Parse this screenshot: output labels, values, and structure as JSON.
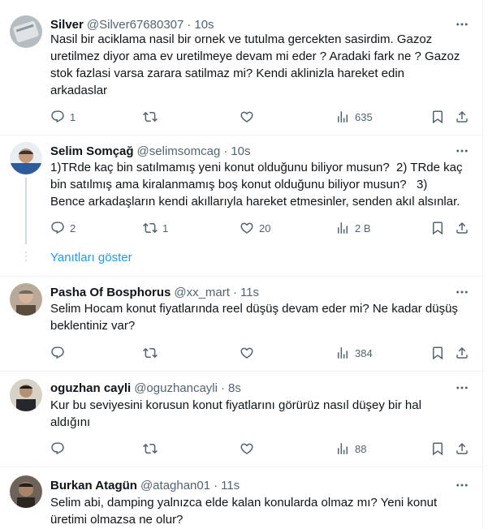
{
  "tweets": [
    {
      "name": "Silver",
      "handle": "@Silver67680307",
      "time": "10s",
      "text": "Nasil bir aciklama nasil bir ornek ve tutulma gercekten sasirdim. Gazoz\nuretilmez diyor ama ev uretilmeye devam mi eder ? Aradaki fark ne ? Gazoz\nstok fazlasi varsa zarara satilmaz mi? Kendi aklinizla hareket edin\narkadaslar",
      "replies": "1",
      "retweets": "",
      "likes": "",
      "views": "635",
      "avatar_color": "#9aa3a9"
    },
    {
      "name": "Selim Somçağ",
      "handle": "@selimsomcag",
      "time": "10s",
      "text": "1)TRde kaç bin satılmamış yeni konut olduğunu biliyor musun?  2) TRde kaç\nbin satılmış ama kiralanmamış boş konut olduğunu biliyor musun?   3)\nBence arkadaşların kendi akıllarıyla hareket etmesinler, senden akıl alsınlar.",
      "replies": "2",
      "retweets": "1",
      "likes": "20",
      "views": "2 B",
      "avatar_color": "#3d4a5c"
    },
    {
      "name": "Pasha Of Bosphorus",
      "handle": "@xx_mart",
      "time": "11s",
      "text": "Selim Hocam konut fiyatlarında reel düşüş devam eder mi? Ne kadar düşüş\nbeklentiniz var?",
      "replies": "",
      "retweets": "",
      "likes": "",
      "views": "384",
      "avatar_color": "#8a7766"
    },
    {
      "name": "oguzhan cayli",
      "handle": "@oguzhancayli",
      "time": "8s",
      "text": "Kur bu seviyesini korusun konut fiyatlarını görürüz nasıl düşey bir hal\naldığını",
      "replies": "",
      "retweets": "",
      "likes": "",
      "views": "88",
      "avatar_color": "#2f3033"
    },
    {
      "name": "Burkan Atagün",
      "handle": "@ataghan01",
      "time": "11s",
      "text": "Selim abi, damping yalnızca elde kalan konularda olmaz mı? Yeni konut\nüretimi olmazsa ne olur?",
      "replies": "",
      "retweets": "",
      "likes": "",
      "views": "",
      "avatar_color": "#4b4038"
    }
  ],
  "show_replies_label": "Yanıtları göster",
  "colors": {
    "accent": "#1d9bf0",
    "secondary_text": "#536471",
    "separator": "#eff3f4"
  }
}
